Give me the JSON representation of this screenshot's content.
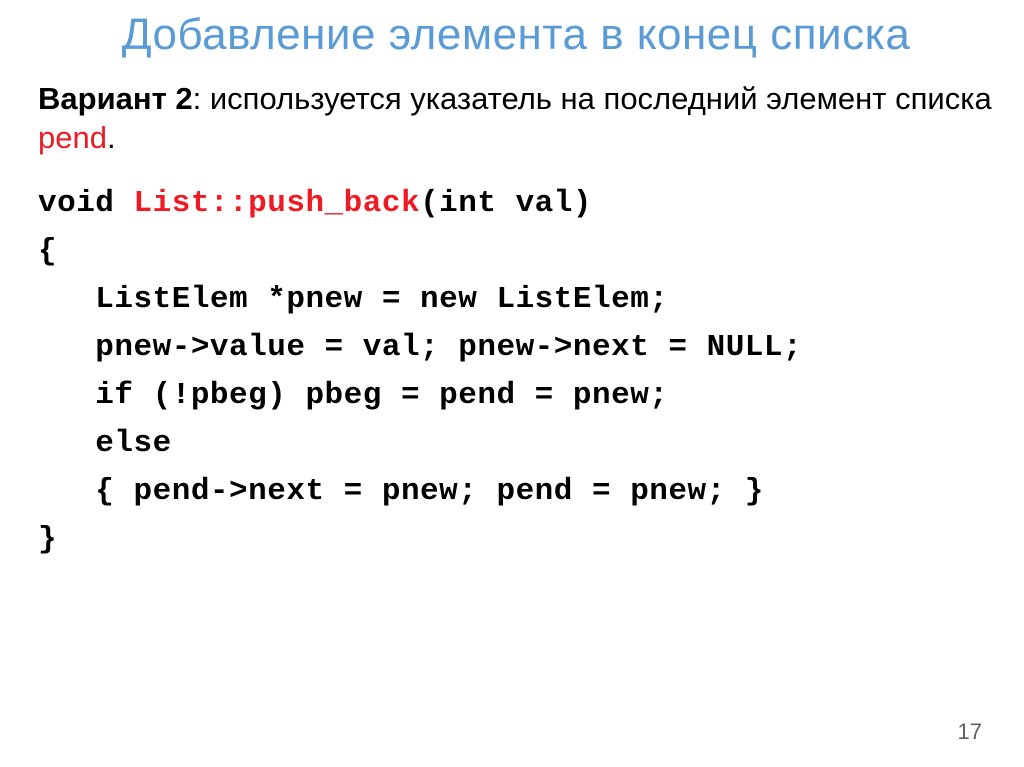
{
  "title": "Добавление элемента в конец списка",
  "variant_label": "Вариант 2",
  "body_part1": ": используется указатель на последний элемент списка  ",
  "pointer_name": "pend",
  "body_part2": ".",
  "code": {
    "l1a": "void ",
    "l1b": "List::push_back",
    "l1c": "(int val)",
    "l2": "{",
    "l3": "   ListElem *pnew = new ListElem;",
    "l4": "   pnew->value = val; pnew->next = NULL;",
    "l5": "   if (!pbeg) pbeg = pend = pnew;",
    "l6": "   else",
    "l7": "   { pend->next = pnew; pend = pnew; }",
    "l8": "}"
  },
  "page_number": "17"
}
